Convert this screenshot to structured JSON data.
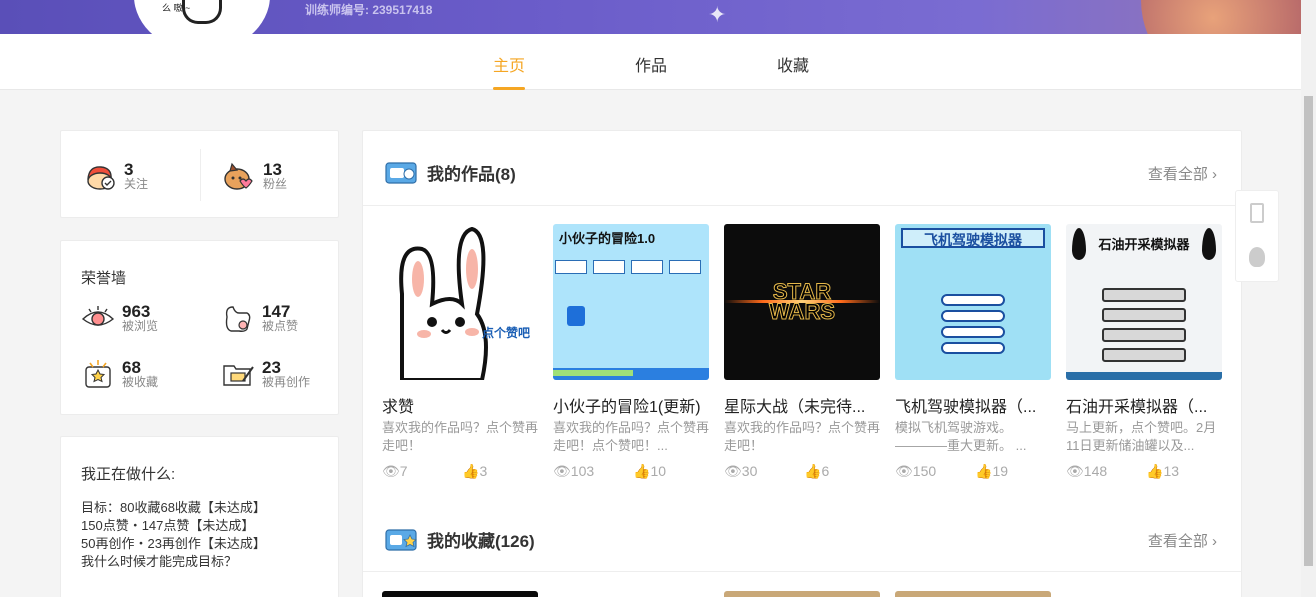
{
  "profile": {
    "trainer_id": "训练师编号: 239517418",
    "avatar_text": "么\n嗷\n~"
  },
  "tabs": [
    {
      "label": "主页",
      "active": true
    },
    {
      "label": "作品",
      "active": false
    },
    {
      "label": "收藏",
      "active": false
    }
  ],
  "social": {
    "following": {
      "count": "3",
      "label": "关注"
    },
    "fans": {
      "count": "13",
      "label": "粉丝"
    }
  },
  "honor": {
    "title": "荣誉墙",
    "stats": [
      {
        "count": "963",
        "label": "被浏览",
        "icon": "eye-icon"
      },
      {
        "count": "147",
        "label": "被点赞",
        "icon": "thumb-icon"
      },
      {
        "count": "68",
        "label": "被收藏",
        "icon": "star-box-icon"
      },
      {
        "count": "23",
        "label": "被再创作",
        "icon": "pencil-folder-icon"
      }
    ]
  },
  "doing": {
    "title": "我正在做什么:",
    "lines": [
      "目标：80收藏68收藏【未达成】",
      "150点赞・147点赞【未达成】",
      "50再创作・23再创作【未达成】",
      "我什么时候才能完成目标？"
    ]
  },
  "my_works": {
    "title": "我的作品(8)",
    "see_all": "查看全部",
    "items": [
      {
        "title": "求赞",
        "desc": "喜欢我的作品吗？点个赞再走吧！",
        "views": "7",
        "likes": "3",
        "thumb_text": "点个赞吧"
      },
      {
        "title": "小伙子的冒险1(更新)",
        "desc": "喜欢我的作品吗？点个赞再走吧！点个赞吧！...",
        "views": "103",
        "likes": "10",
        "thumb_text": "小伙子的冒险1.0"
      },
      {
        "title": "星际大战（未完待...",
        "desc": "喜欢我的作品吗？点个赞再走吧！",
        "views": "30",
        "likes": "6",
        "thumb_text": "STAR WARS"
      },
      {
        "title": "飞机驾驶模拟器（...",
        "desc": "模拟飞机驾驶游戏。————重大更新。 ...",
        "views": "150",
        "likes": "19",
        "thumb_text": "飞机驾驶模拟器"
      },
      {
        "title": "石油开采模拟器（...",
        "desc": "马上更新，点个赞吧。2月11日更新储油罐以及...",
        "views": "148",
        "likes": "13",
        "thumb_text": "石油开采模拟器"
      }
    ]
  },
  "my_favorites": {
    "title": "我的收藏(126)",
    "see_all": "查看全部"
  },
  "colors": {
    "accent": "#f5a623",
    "banner": "#5a4fb8"
  }
}
